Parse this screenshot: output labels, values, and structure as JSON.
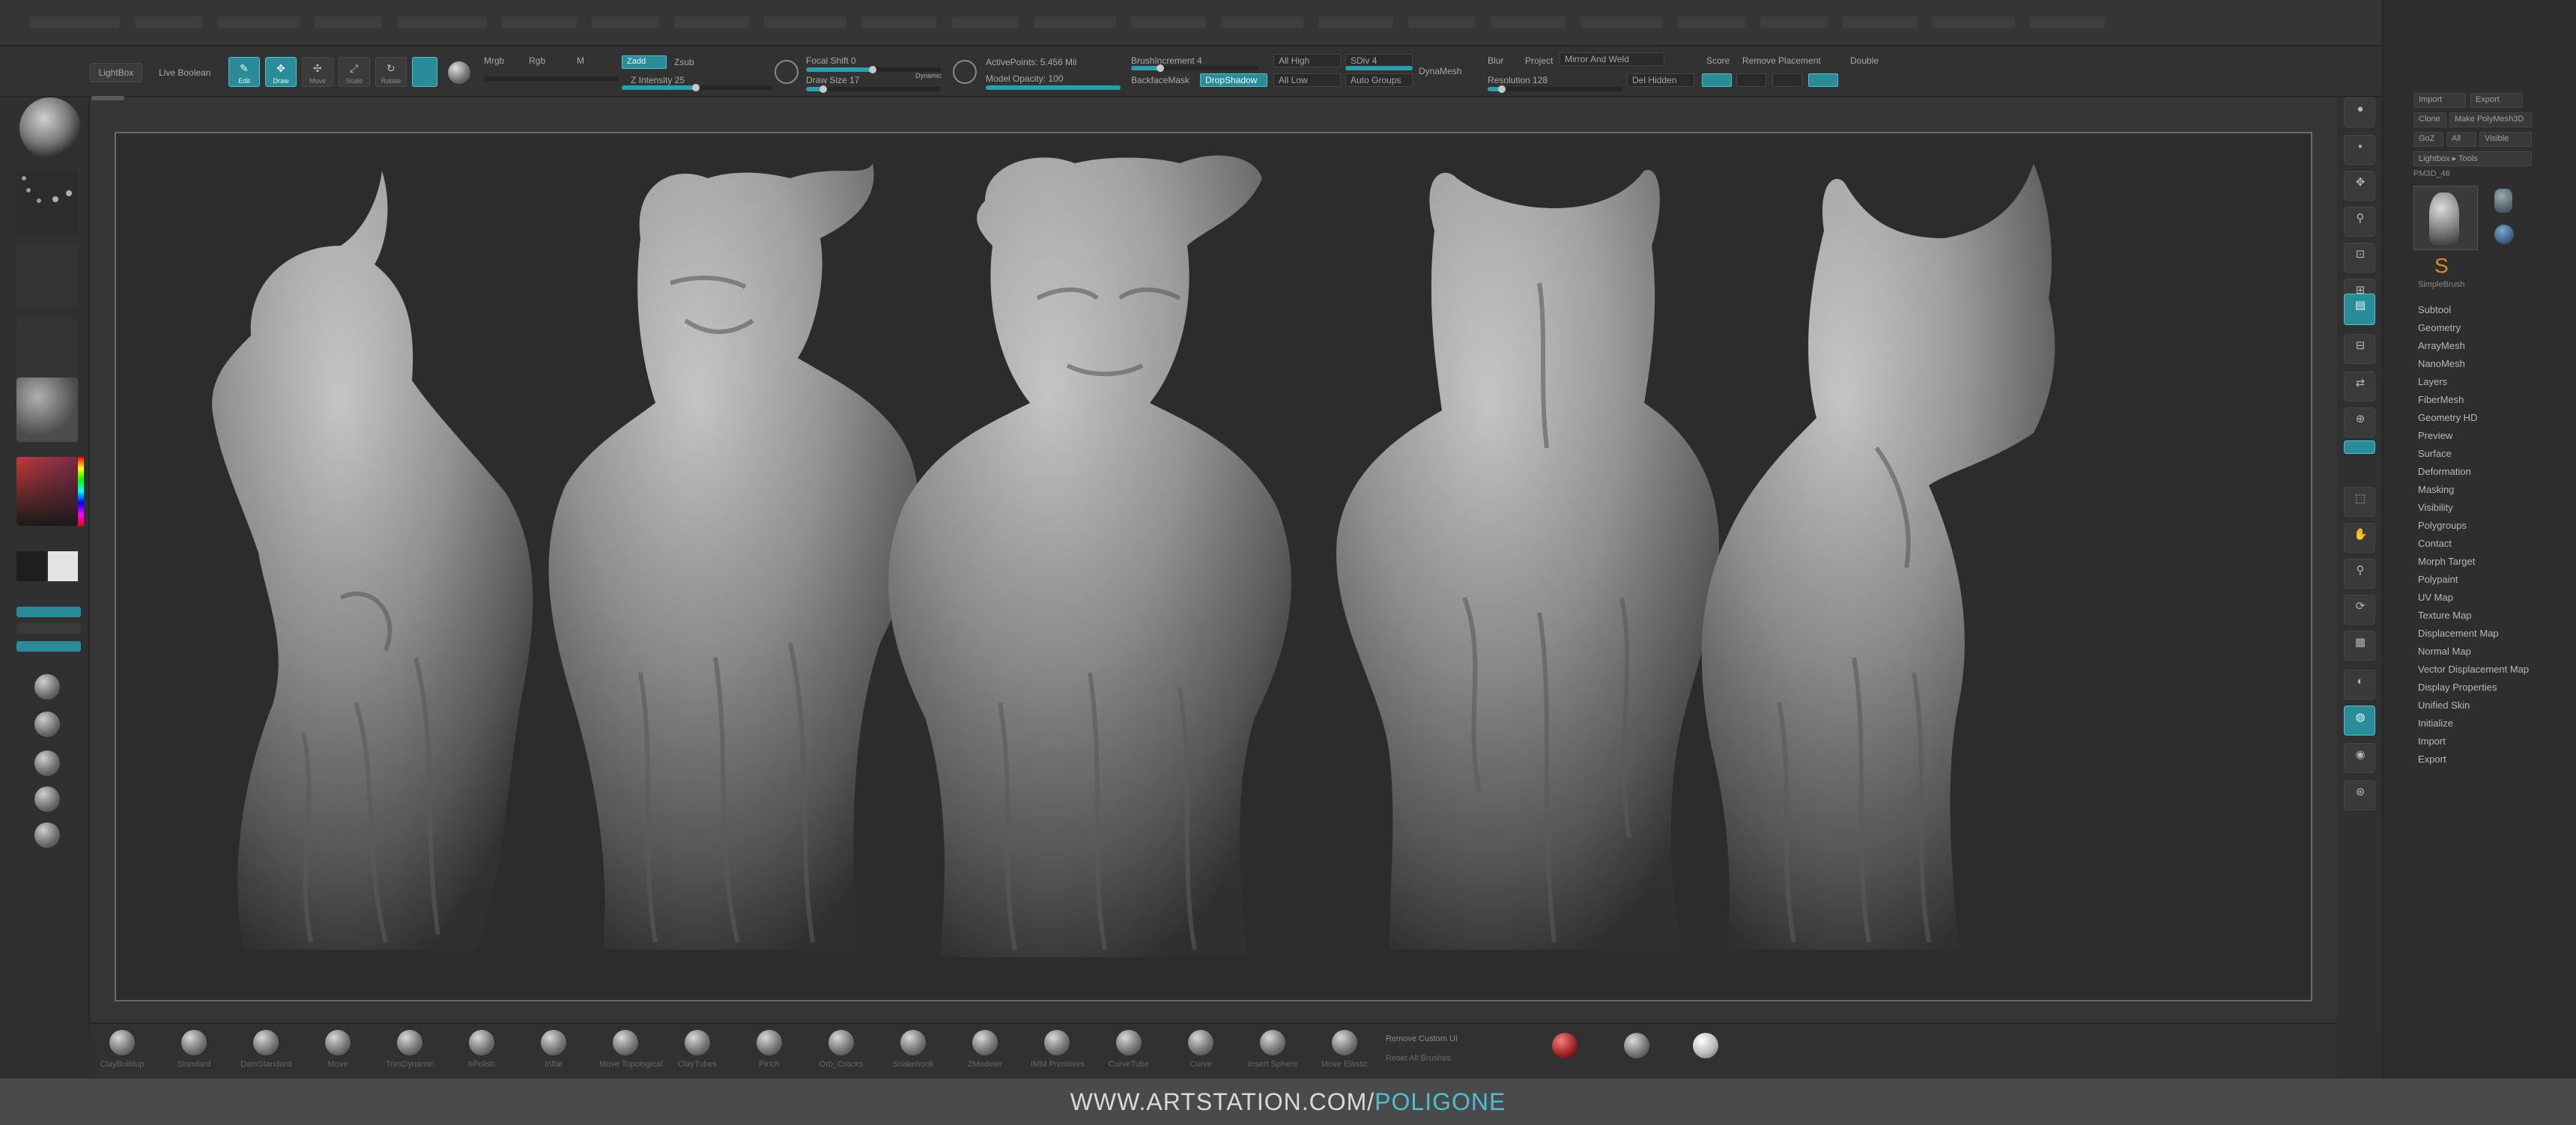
{
  "footer": {
    "url": "WWW.ARTSTATION.COM",
    "separator": "/",
    "name": "POLIGONE"
  },
  "toolbar": {
    "light_box": "LightBox",
    "live_boolean": "Live Boolean",
    "edit": "Edit",
    "draw": "Draw",
    "move": "Move",
    "scale": "Scale",
    "rotate": "Rotate",
    "mrgb": "Mrgb",
    "rgb": "Rgb",
    "m": "M",
    "zadd": "Zadd",
    "zsub": "Zsub",
    "z_intensity": "Z Intensity 25",
    "focal_shift": "Focal Shift 0",
    "draw_size": "Draw Size 17",
    "dynamic": "Dynamic",
    "active_points": "ActivePoints: 5.456 Mil",
    "model_opacity": "Model Opacity: 100",
    "brush_increment": "BrushIncrement 4",
    "backface_mask": "BackfaceMask",
    "drop_shadow": "DropShadow",
    "all_high": "All High",
    "all_low": "All Low",
    "sdiv": "SDiv 4",
    "auto_groups": "Auto Groups",
    "dyna_mesh": "DynaMesh",
    "blur": "Blur",
    "project": "Project",
    "mirror_and_weld": "Mirror And Weld",
    "score": "Score",
    "remove_placement": "Remove Placement",
    "double": "Double",
    "resolution": "Resolution 128",
    "del_hidden": "Del Hidden"
  },
  "right_panel": {
    "subpalette_items": [
      "Subtool",
      "Geometry",
      "ArrayMesh",
      "NanoMesh",
      "Layers",
      "FiberMesh",
      "Geometry HD",
      "Preview",
      "Surface",
      "Deformation",
      "Masking",
      "Visibility",
      "Polygroups",
      "Contact",
      "Morph Target",
      "Polypaint",
      "UV Map",
      "Texture Map",
      "Displacement Map",
      "Normal Map",
      "Vector Displacement Map",
      "Display Properties",
      "Unified Skin",
      "Initialize",
      "Import",
      "Export"
    ],
    "tool_buttons": [
      "Import",
      "Export",
      "Clone",
      "Make PolyMesh3D",
      "GoZ",
      "All",
      "Visible",
      "Lightbox ▸ Tools"
    ],
    "pm3d_label": "PM3D_46",
    "tool_thumb_label": "SimpleBrush"
  },
  "bottom_tray": {
    "brushes": [
      "ClayBuildup",
      "Standard",
      "DamStandard",
      "Move",
      "TrimDynamic",
      "hPolish",
      "Inflat",
      "Move Topological",
      "ClayTubes",
      "Pinch",
      "Orb_Cracks",
      "Snakehook",
      "ZModeler",
      "IMM Primitives",
      "CurveTube",
      "Curve",
      "Insert Sphere",
      "Move Elastic"
    ],
    "remove_custom_ui": "Remove Custom UI",
    "reset_all_brushes": "Reset All Brushes"
  },
  "colors": {
    "teal_accent": "#2a8c98",
    "footer_name": "#4dbfd0",
    "canvas_bg": "#2c2c2c"
  }
}
